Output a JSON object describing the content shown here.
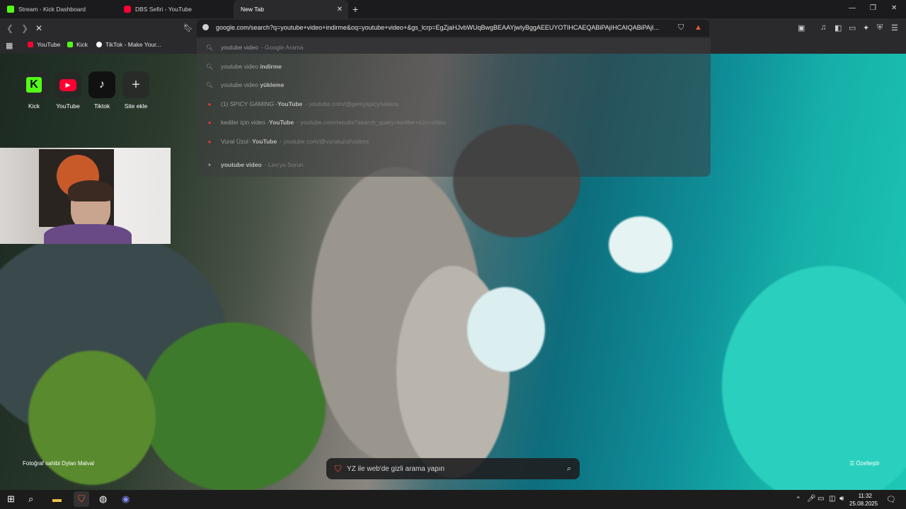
{
  "tabs": [
    {
      "title": "Stream - Kick Dashboard",
      "color": "#53fc18"
    },
    {
      "title": "DBS Sefiri - YouTube",
      "color": "#ff0033"
    },
    {
      "title": "New Tab",
      "color": ""
    }
  ],
  "toolbar": {
    "url": "google.com/search?q=youtube+video+indirme&oq=youtube+video+&gs_lcrp=EgZjaHJvbWUqBwgBEAAYjwIyBggAEEUYOTIHCAEQABiPAjIHCAIQABiPAjI..."
  },
  "bookmarks": [
    {
      "label": "YouTube",
      "color": "#ff0033"
    },
    {
      "label": "Kick",
      "color": "#53fc18"
    },
    {
      "label": "TikTok - Make Your...",
      "color": "#ffffff"
    }
  ],
  "suggestions": [
    {
      "prefix": "youtube video",
      "bold": "",
      "suffix": "- Google Arama",
      "icon": "search-icon"
    },
    {
      "prefix": "youtube video ",
      "bold": "indirme",
      "suffix": "",
      "icon": "search-icon"
    },
    {
      "prefix": "youtube video ",
      "bold": "yükleme",
      "suffix": "",
      "icon": "search-icon"
    },
    {
      "prefix": "(1) SPICY GAMING - ",
      "bold": "YouTube",
      "suffix": "- youtube.com/@gemyspicy/videos",
      "icon": "youtube-icon"
    },
    {
      "prefix": "kediler için video - ",
      "bold": "YouTube",
      "suffix": "- youtube.com/results?search_query=kediler+için+video",
      "icon": "youtube-icon"
    },
    {
      "prefix": "Vural Üzul - ",
      "bold": "YouTube",
      "suffix": "- youtube.com/@vuraluzul/videos",
      "icon": "youtube-icon"
    },
    {
      "prefix": "",
      "bold": "youtube video",
      "suffix": "- Leo'ya Sorun",
      "icon": "leo-icon"
    }
  ],
  "shortcuts": [
    {
      "label": "Kick",
      "color": "#53fc18",
      "glyph": "K"
    },
    {
      "label": "YouTube",
      "color": "#ff0033",
      "glyph": "▶"
    },
    {
      "label": "Tiktok",
      "color": "#111111",
      "glyph": "♪"
    },
    {
      "label": "Site ekle",
      "color": "",
      "glyph": "+"
    }
  ],
  "footer": {
    "photo_credit": "Fotoğraf sahibi Dylan Malval",
    "customize": "Özelleştir",
    "private_search_placeholder": "YZ ile web'de gizli arama yapın"
  },
  "taskbar": {
    "time": "11:32",
    "date": "25.08.2025"
  }
}
